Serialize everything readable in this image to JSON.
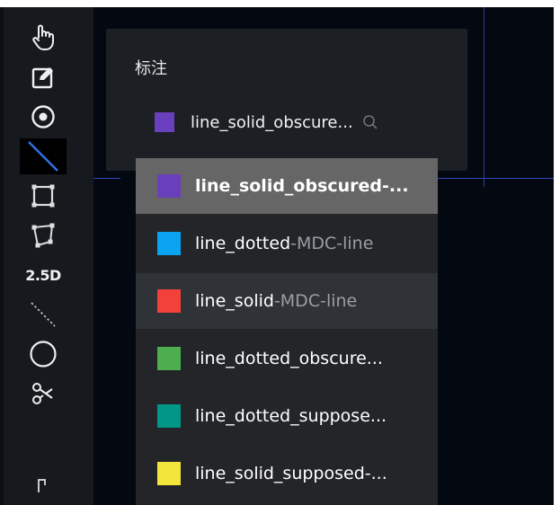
{
  "toolbar": {
    "tools": [
      {
        "name": "pan",
        "icon": "hand-icon"
      },
      {
        "name": "edit",
        "icon": "edit-icon"
      },
      {
        "name": "point",
        "icon": "target-point-icon"
      },
      {
        "name": "line",
        "icon": "line-icon",
        "active": true
      },
      {
        "name": "rectangle",
        "icon": "rectangle-icon"
      },
      {
        "name": "polygon",
        "icon": "polygon-icon"
      },
      {
        "name": "cuboid",
        "label": "2.5D"
      },
      {
        "name": "dashed-line",
        "icon": "dashed-line-icon"
      },
      {
        "name": "circle",
        "icon": "circle-icon"
      },
      {
        "name": "cut",
        "icon": "scissors-icon"
      },
      {
        "name": "more",
        "icon": "bracket-icon"
      }
    ]
  },
  "label_panel": {
    "title": "标注",
    "current": {
      "text": "line_solid_obscure...",
      "color": "#6a3fbd"
    },
    "search_icon": "search-icon"
  },
  "dropdown": {
    "options": [
      {
        "name": "line_solid_obscured-...",
        "suffix": "",
        "color": "#6a3fbd",
        "state": "selected"
      },
      {
        "name": "line_dotted",
        "suffix": "-MDC-line",
        "color": "#0aa3f0",
        "state": ""
      },
      {
        "name": "line_solid",
        "suffix": "-MDC-line",
        "color": "#f2403a",
        "state": "hover"
      },
      {
        "name": "line_dotted_obscure...",
        "suffix": "",
        "color": "#4cae4f",
        "state": ""
      },
      {
        "name": "line_dotted_suppose...",
        "suffix": "",
        "color": "#009688",
        "state": ""
      },
      {
        "name": "line_solid_supposed-...",
        "suffix": "",
        "color": "#f4e53c",
        "state": ""
      }
    ]
  },
  "colors": {
    "background": "#000611",
    "toolbar": "#16191d",
    "panel": "#1c1f24",
    "dropdown": "#232528"
  }
}
